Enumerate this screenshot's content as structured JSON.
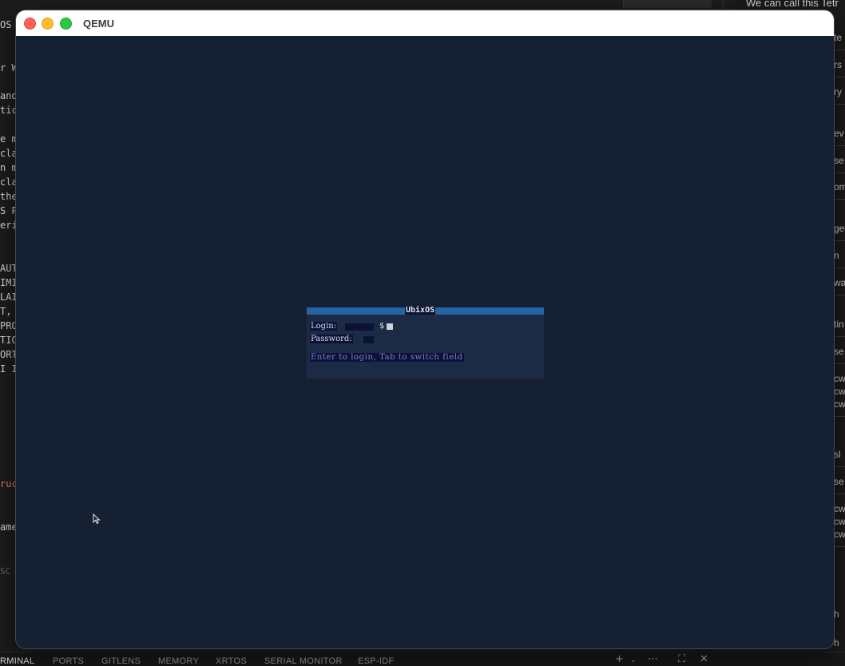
{
  "background": {
    "right_panel_top_text": "We can call this Tetr",
    "right_panel_fragments": [
      "te",
      "rs",
      "ry",
      "ev",
      "se",
      "om",
      "get",
      "n",
      "wa",
      "tin",
      "se",
      "cw",
      "cw",
      "cw",
      "sl",
      "se",
      "cw",
      "cw",
      "cw",
      "h",
      "h"
    ],
    "editor_fragments": [
      "OS F",
      "r W.",
      "and",
      "tic",
      "e mu",
      "clai",
      "n mu",
      "clai",
      "the",
      "S Pr",
      "eriv",
      "AUT",
      "IMIT",
      "LAI",
      "T,",
      "PROC",
      "TION",
      "ORT",
      "I IF",
      "ruc",
      "ame,",
      "SC"
    ],
    "bottom_tabs": [
      "RMINAL",
      "PORTS",
      "GITLENS",
      "MEMORY",
      "XRTOS",
      "SERIAL MONITOR",
      "ESP-IDF"
    ]
  },
  "qemu": {
    "window_title": "QEMU",
    "login": {
      "title": "UbixOS",
      "login_label": "Login:",
      "prompt_symbol": "$",
      "password_label": "Password:",
      "hint": "Enter to login, Tab to switch field"
    }
  },
  "colors": {
    "screen_bg": "#152033",
    "box_bg": "#1b2a45",
    "header_bar": "#2563a4",
    "label_bg": "#0b1236",
    "hint_text": "#7f7fd8"
  }
}
